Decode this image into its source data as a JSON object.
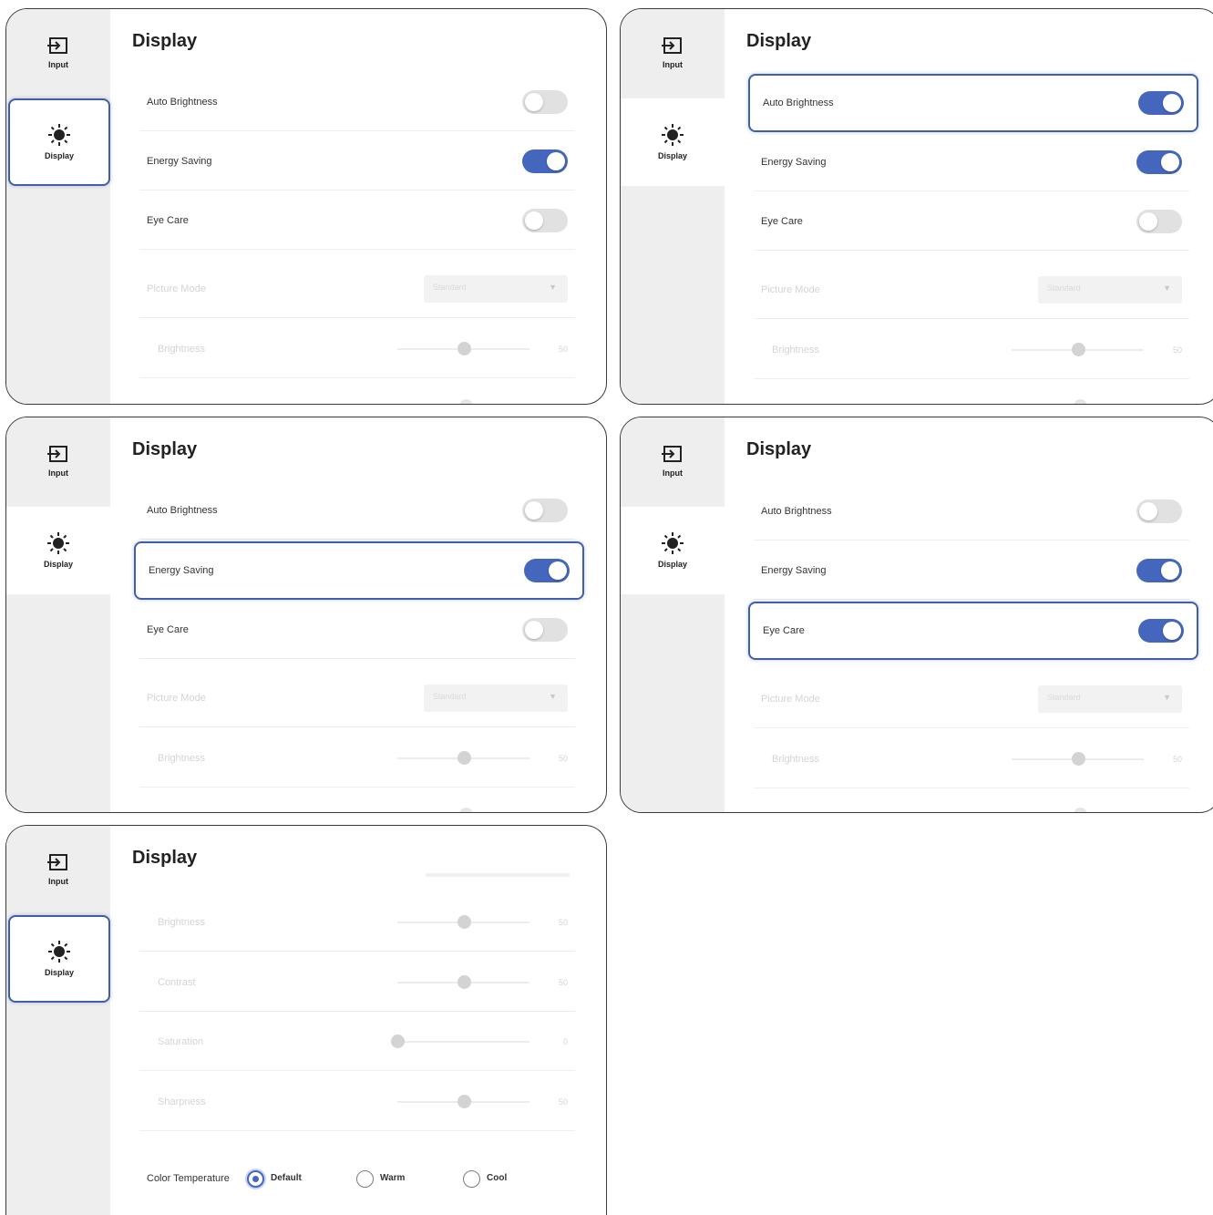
{
  "sidebar": {
    "input_label": "Input",
    "input_icon": "input-icon",
    "display_label": "Display",
    "display_icon": "sun-icon"
  },
  "page_title": "Display",
  "settings": {
    "auto_brightness": "Auto Brightness",
    "energy_saving": "Energy Saving",
    "eye_care": "Eye Care",
    "picture_mode": "Picture Mode",
    "picture_mode_value": "Standard",
    "brightness": "Brightness",
    "contrast": "Contrast",
    "saturation": "Saturation",
    "sharpness": "Sharpness"
  },
  "sliders": {
    "brightness": {
      "value": "50",
      "fraction": 0.5
    },
    "contrast": {
      "value": "50",
      "fraction": 0.5
    },
    "saturation": {
      "value": "0",
      "fraction": 0.0
    },
    "sharpness": {
      "value": "50",
      "fraction": 0.5
    }
  },
  "color_temperature": {
    "label": "Color Temperature",
    "options": [
      "Default",
      "Warm",
      "Cool"
    ],
    "selected": "Default"
  },
  "toggle_states": [
    {
      "auto_brightness": false,
      "energy_saving": true,
      "eye_care": false
    },
    {
      "auto_brightness": true,
      "energy_saving": true,
      "eye_care": false
    },
    {
      "auto_brightness": false,
      "energy_saving": true,
      "eye_care": false
    },
    {
      "auto_brightness": false,
      "energy_saving": true,
      "eye_care": true
    }
  ],
  "colors": {
    "accent": "#4467bd",
    "toggle_off": "#e1e1e1",
    "sidebar_bg": "#eeeeee",
    "focus_border": "#3f5fa8"
  }
}
